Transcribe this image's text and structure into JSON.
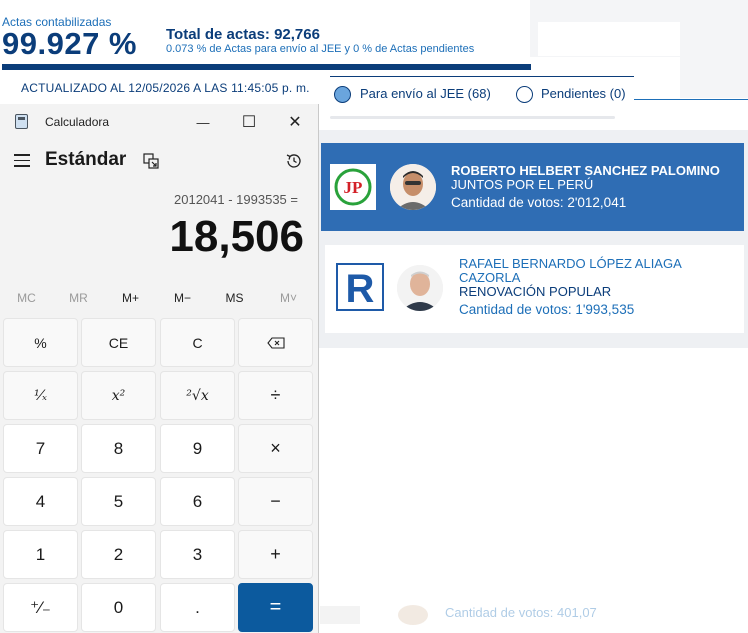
{
  "web": {
    "actas_label": "Actas contabilizadas",
    "actas_percent": "99.927 %",
    "total_actas": "Total de actas: 92,766",
    "actas_note": "0.073 % de Actas para envío al JEE y 0 % de Actas pendientes",
    "updated": "ACTUALIZADO AL 12/05/2026 A LAS 11:45:05 p. m.",
    "filters": [
      {
        "label": "Para envío al JEE (68)",
        "selected": true
      },
      {
        "label": "Pendientes (0)",
        "selected": false
      }
    ],
    "candidates": [
      {
        "name": "ROBERTO HELBERT SANCHEZ PALOMINO",
        "party": "JUNTOS POR EL PERÚ",
        "votes": "Cantidad de votos: 2'012,041",
        "logo_text": "JP"
      },
      {
        "name_line1": "RAFAEL BERNARDO LÓPEZ ALIAGA",
        "name_line2": "CAZORLA",
        "party": "RENOVACIÓN POPULAR",
        "votes": "Cantidad de votos: 1'993,535",
        "logo_text": "R"
      }
    ],
    "bottom_remnant": "Cantidad de votos: 401,07",
    "colors": {
      "navy": "#0b3d7a",
      "blue": "#1d6fb8",
      "highlight": "#2f6db4"
    }
  },
  "calculator": {
    "app_title": "Calculadora",
    "mode": "Estándar",
    "expression": "2012041 - 1993535 =",
    "result": "18,506",
    "window_buttons": {
      "minimize": "—",
      "maximize": "☐",
      "close": "✕"
    },
    "memory": [
      "MC",
      "MR",
      "M+",
      "M−",
      "MS",
      "M˅"
    ],
    "keys": [
      [
        "%",
        "CE",
        "C",
        "⌫"
      ],
      [
        "¹⁄ₓ",
        "x²",
        "²√x",
        "÷"
      ],
      [
        "7",
        "8",
        "9",
        "×"
      ],
      [
        "4",
        "5",
        "6",
        "−"
      ],
      [
        "1",
        "2",
        "3",
        "+"
      ],
      [
        "⁺⁄₋",
        "0",
        ".",
        "="
      ]
    ]
  }
}
